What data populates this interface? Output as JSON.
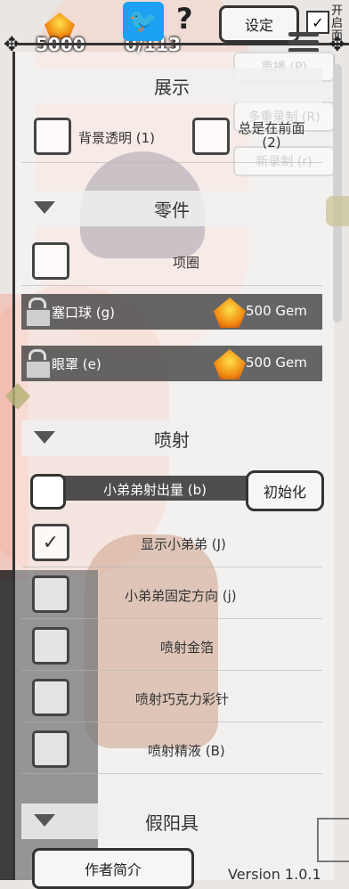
{
  "topbar": {
    "gem_count": "5000",
    "counter": "0/113",
    "settings_label": "设定",
    "help_label": "?",
    "top_check_label": "开启面",
    "twitter_icon": "🐦"
  },
  "ghost_buttons": {
    "replay": "重播 (P)",
    "multi_record": "多重录制 (R)",
    "new_record": "新录制 (r)"
  },
  "sections": {
    "display": "展示",
    "parts": "零件",
    "spray": "喷射",
    "dildo": "假阳具"
  },
  "display": {
    "bg_transparent": "背景透明 (1)",
    "always_front": "总是在前面 (2)"
  },
  "parts": {
    "collar": "项圈",
    "gag": "塞口球 (g)",
    "gag_price": "500 Gem",
    "blindfold": "眼罩 (e)",
    "blindfold_price": "500 Gem"
  },
  "spray": {
    "amount_label": "小弟弟射出量 (b)",
    "reset_label": "初始化",
    "show": "显示小弟弟 (J)",
    "fix_direction": "小弟弟固定方向 (j)",
    "gold_foil": "喷射金箔",
    "choco_sprinkles": "喷射巧克力彩针",
    "semen": "喷射精液 (B)",
    "show_checked": "✓"
  },
  "footer": {
    "author": "作者简介",
    "version": "Version 1.0.1"
  }
}
